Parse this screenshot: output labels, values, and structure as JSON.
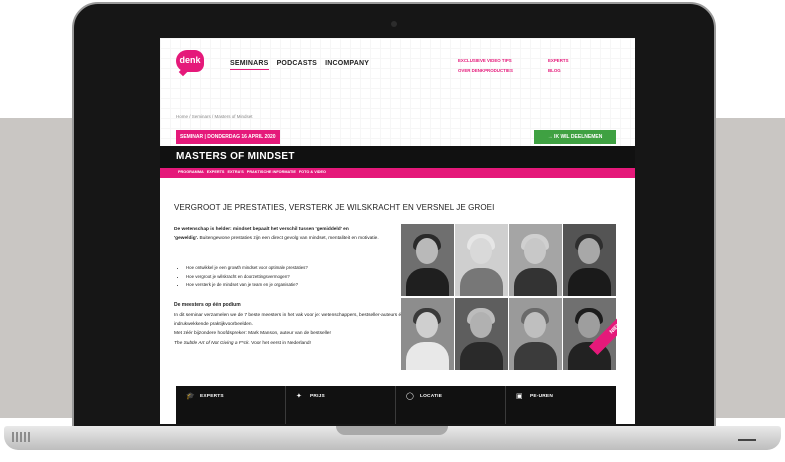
{
  "header": {
    "logo": "denk",
    "nav": [
      "SEMINARS",
      "PODCASTS",
      "INCOMPANY"
    ],
    "toplinks_left": [
      "EXCLUSIEVE VIDEO TIPS",
      "OVER DENKPRODUCTIES"
    ],
    "toplinks_right": [
      "EXPERTS",
      "BLOG"
    ]
  },
  "breadcrumb": "Home / Seminars / Masters of Mindset",
  "event": {
    "date_tag": "SEMINAR | DONDERDAG 16 APRIL 2020",
    "cta": "→  IK WIL DEELNEMEN",
    "title": "MASTERS OF MINDSET",
    "tabs": [
      "PROGRAMMA",
      "EXPERTS",
      "EXTRA'S",
      "PRAKTISCHE INFORMATIE",
      "FOTO & VIDEO"
    ]
  },
  "content": {
    "headline": "VERGROOT JE PRESTATIES, VERSTERK JE WILSKRACHT EN VERSNEL JE GROEI",
    "intro_bold": "De wetenschap is helder: mindset bepaalt het verschil tussen 'gemiddeld' en",
    "intro_bold2": "'geweldig'.",
    "intro_rest": " Buitengewone prestaties zijn een direct gevolg van mindset, mentaliteit en motivatie.",
    "bullets": [
      "Hoe ontwikkel je een growth mindset voor optimale prestaties?",
      "Hoe vergroot je wilskracht en doorzettingsvermogen?",
      "Hoe versterk je de mindset van je team en je organisatie?"
    ],
    "subheading": "De meesters op één podium",
    "para1": "In dit seminar verzamelen we de 7 beste meesters in het vak voor je: wetenschappers, bestseller-auteurs én indrukwekkende praktijkvoorbeelden.",
    "para2": "Met zéér bijzondere hoofdspreker: Mark Manson, auteur van de bestseller",
    "book": "The Subtle Art of Not Giving a F*ck.",
    "para3": " Voor het eerst in Nederland!",
    "badge": "NIEUW!"
  },
  "bottombar": [
    {
      "icon": "graduation-cap-icon",
      "glyph": "🎓",
      "label": "EXPERTS"
    },
    {
      "icon": "ticket-icon",
      "glyph": "✦",
      "label": "PRIJS"
    },
    {
      "icon": "map-pin-icon",
      "glyph": "◯",
      "label": "LOCATIE"
    },
    {
      "icon": "calendar-icon",
      "glyph": "▣",
      "label": "PE-UREN"
    }
  ],
  "colors": {
    "brand": "#e5197a",
    "cta": "#3fa142",
    "dark": "#111111"
  }
}
